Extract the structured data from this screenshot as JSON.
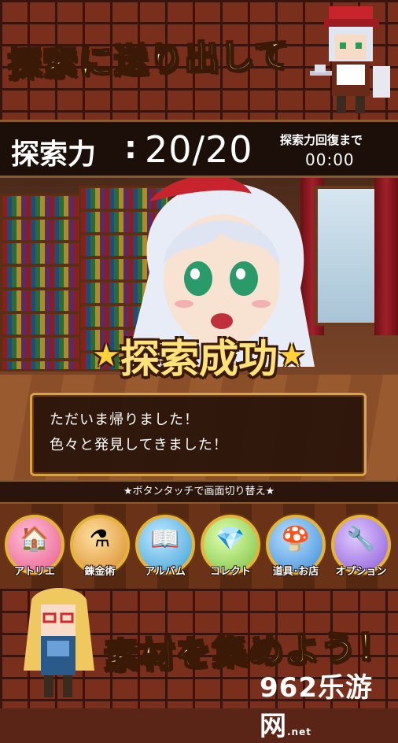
{
  "top_banner": {
    "headline": "探索に送り出して"
  },
  "status": {
    "power_label": "探索力",
    "power_colon": ":",
    "power_value": "20/20",
    "recover_label": "探索力回復まで",
    "recover_time": "00:00"
  },
  "result": {
    "title": "探索成功",
    "star": "★",
    "dialog": [
      "ただいま帰りました！",
      "色々と発見してきました！"
    ]
  },
  "hint": "★ボタンタッチで画面切り替え★",
  "menu": [
    {
      "label": "アトリエ",
      "icon": "house-icon",
      "color": "#e85a8a"
    },
    {
      "label": "錬金術",
      "icon": "flask-icon",
      "color": "#d98a2a"
    },
    {
      "label": "アルバム",
      "icon": "album-icon",
      "color": "#3aa0d8"
    },
    {
      "label": "コレクト",
      "icon": "chest-icon",
      "color": "#7ac040"
    },
    {
      "label": "道具･お店",
      "icon": "mushroom-icon",
      "color": "#3a8ad8"
    },
    {
      "label": "オプション",
      "icon": "wrench-icon",
      "color": "#8a5ad8"
    }
  ],
  "bottom_banner": {
    "headline": "素材を集めよう！"
  },
  "watermark": {
    "main": "962",
    "side": "乐游网",
    "sub": ".net"
  }
}
